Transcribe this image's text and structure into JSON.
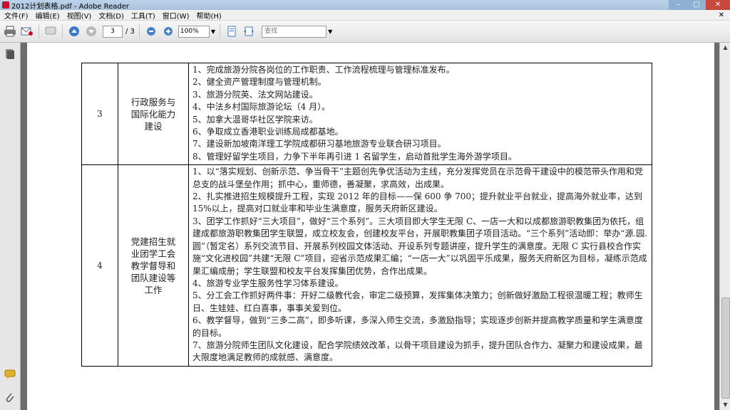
{
  "window": {
    "title": "2012计划表格.pdf - Adobe Reader",
    "controls": {
      "minimize": "–",
      "maximize": "□",
      "close": "✕"
    }
  },
  "menu": {
    "items": [
      "文件(F)",
      "编辑(E)",
      "视图(V)",
      "文档(D)",
      "工具(T)",
      "窗口(W)",
      "帮助(H)"
    ],
    "close_glyph": "✕"
  },
  "toolbar": {
    "page_current": "3",
    "page_total": "/ 3",
    "zoom": "100%",
    "search_placeholder": "查找",
    "icons": [
      "print-icon",
      "email-icon",
      "prev-page-icon",
      "next-page-icon",
      "zoom-out-icon",
      "zoom-in-icon",
      "fit-page-icon",
      "fit-width-icon",
      "dropdown-arrow-icon"
    ]
  },
  "leftpanel": {
    "icons": [
      "pages-icon",
      "comments-icon",
      "attachments-icon"
    ]
  },
  "document": {
    "rows": [
      {
        "number": "3",
        "category": [
          "行政服务与",
          "国际化能力",
          "建设"
        ],
        "items": [
          "1、完成旅游分院各岗位的工作职责、工作流程梳理与管理标准发布。",
          "2、健全资产管理制度与管理机制。",
          "3、旅游分院英、法文网站建设。",
          "4、中法乡村国际旅游论坛（4 月）。",
          "5、加拿大温哥华社区学院来访。",
          "6、争取成立香港职业训练局成都基地。",
          "7、建设新加坡南洋理工学院成都研习基地旅游专业联合研习项目。",
          "8、管理好留学生项目，力争下半年再引进 1 名留学生，启动首批学生海外游学项目。"
        ]
      },
      {
        "number": "4",
        "category": [
          "党建招生就",
          "业团学工会",
          "教学督导和",
          "团队建设等",
          "工作"
        ],
        "items": [
          "1、以“落实规划、创新示范、争当骨干”主题创先争优活动为主线，充分发挥党员在示范骨干建设中的模范带头作用和党总支的战斗堡垒作用；抓中心，重师德，善凝聚，求高效，出成果。",
          "2、扎实推进招生规模提升工程，实现 2012 年的目标——保 600 争 700；提升就业平台就业，提高海外就业率，达到 15%以上，提高对口就业率和毕业生满意度，服务天府新区建设。",
          "3、团学工作抓好“三大项目”，做好“三个系列”。三大项目即大学生无限 C、一店一大和以成都旅游职教集团为依托，组建成都旅游职教集团学生联盟，成立校友会，创建校友平台，开展职教集团子项目活动。“三个系列”活动即：举办“源.园.圆”（暂定名）系列交流节目、开展系列校园文体活动、开设系列专题讲座，提升学生的满意度。无限 C 实行县校合作实施“文化进校园”共建“无限 C”项目，迎省示范成果汇编；“一店一大”以巩固平乐成果，服务天府新区为目标，凝练示范成果汇编成册；学生联盟和校友平台发挥集团优势，合作出成果。",
          "4、旅游专业学生服务性学习体系建设。",
          "5、分工会工作抓好两件事：开好二级教代会，审定二级预算，发挥集体决策力；创新做好激励工程很温暖工程；教师生日、生娃娃、红白喜事，事事关爱到位。",
          "6、教学督导，做到“三多二高”，即多听课，多深入师生交流，多激励指导；实现逐步创新并提高教学质量和学生满意度的目标。",
          "7、旅游分院师生团队文化建设，配合学院绩效改革，以骨干项目建设为抓手，提升团队合作力、凝聚力和建设成果，最大限度地满足教师的成就感、满意度。"
        ]
      }
    ]
  },
  "colors": {
    "titlebar": "#bcd3ea",
    "close_button": "#c9473b",
    "background": "#6b6b6b",
    "page": "#ffffff"
  }
}
